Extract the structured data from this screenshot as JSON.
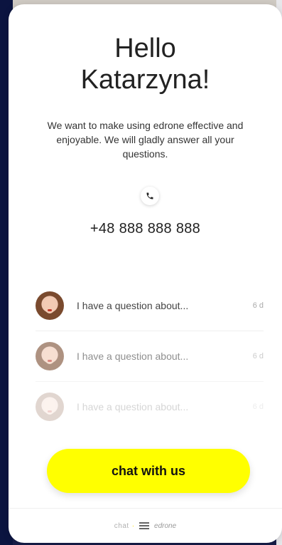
{
  "widget": {
    "greeting_line1": "Hello",
    "greeting_line2": "Katarzyna!",
    "intro": "We want to make using edrone effective and enjoyable. We will gladly answer all your questions.",
    "phone_icon": "phone-icon",
    "phone_number": "+48 888 888 888",
    "conversations": [
      {
        "text": "I have a question about...",
        "time": "6 d"
      },
      {
        "text": "I have a question about...",
        "time": "6 d"
      },
      {
        "text": "I have a question about...",
        "time": "6 d"
      }
    ],
    "chat_button_label": "chat with us",
    "footer": {
      "chat_word": "chat",
      "dot": "·",
      "menu_icon": "menu-icon",
      "brand": "edrone"
    }
  },
  "colors": {
    "accent": "#ffff00",
    "background": "#ffffff",
    "text": "#222222"
  }
}
